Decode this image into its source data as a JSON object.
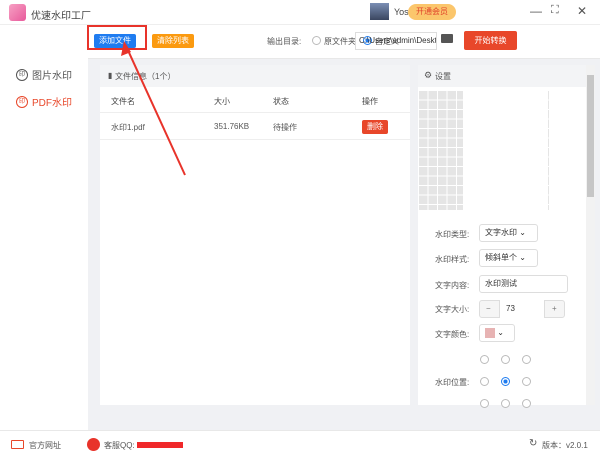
{
  "app": {
    "title": "优速水印工厂",
    "user": "Yososoft",
    "vip_label": "开通会员"
  },
  "sidebar": {
    "items": [
      {
        "label": "图片水印"
      },
      {
        "label": "PDF水印"
      }
    ]
  },
  "toolbar": {
    "add_file": "添加文件",
    "clear_list": "清除列表",
    "output_dir_label": "输出目录:",
    "opt_source": "原文件夹",
    "opt_custom": "自定义",
    "path": "C:\\Users\\admin\\Deskto",
    "start": "开始转换"
  },
  "files": {
    "title": "文件信息（1个）",
    "columns": [
      "文件名",
      "大小",
      "状态",
      "操作"
    ],
    "rows": [
      {
        "name": "水印1.pdf",
        "size": "351.76KB",
        "status": "待操作",
        "action": "删除"
      }
    ]
  },
  "settings": {
    "title": "设置",
    "type_label": "水印类型:",
    "type_value": "文字水印",
    "style_label": "水印样式:",
    "style_value": "倾斜单个",
    "text_label": "文字内容:",
    "text_value": "水印测试",
    "size_label": "文字大小:",
    "size_value": "73",
    "color_label": "文字颜色:",
    "color_value": "#e7b3b3",
    "position_label": "水印位置:",
    "position_selected": 4
  },
  "footer": {
    "website": "官方网址",
    "qq": "客服QQ:",
    "version": "版本：v2.0.1"
  },
  "colors": {
    "accent": "#1f7cf0",
    "danger": "#e8472a",
    "warn": "#fb9a10"
  }
}
